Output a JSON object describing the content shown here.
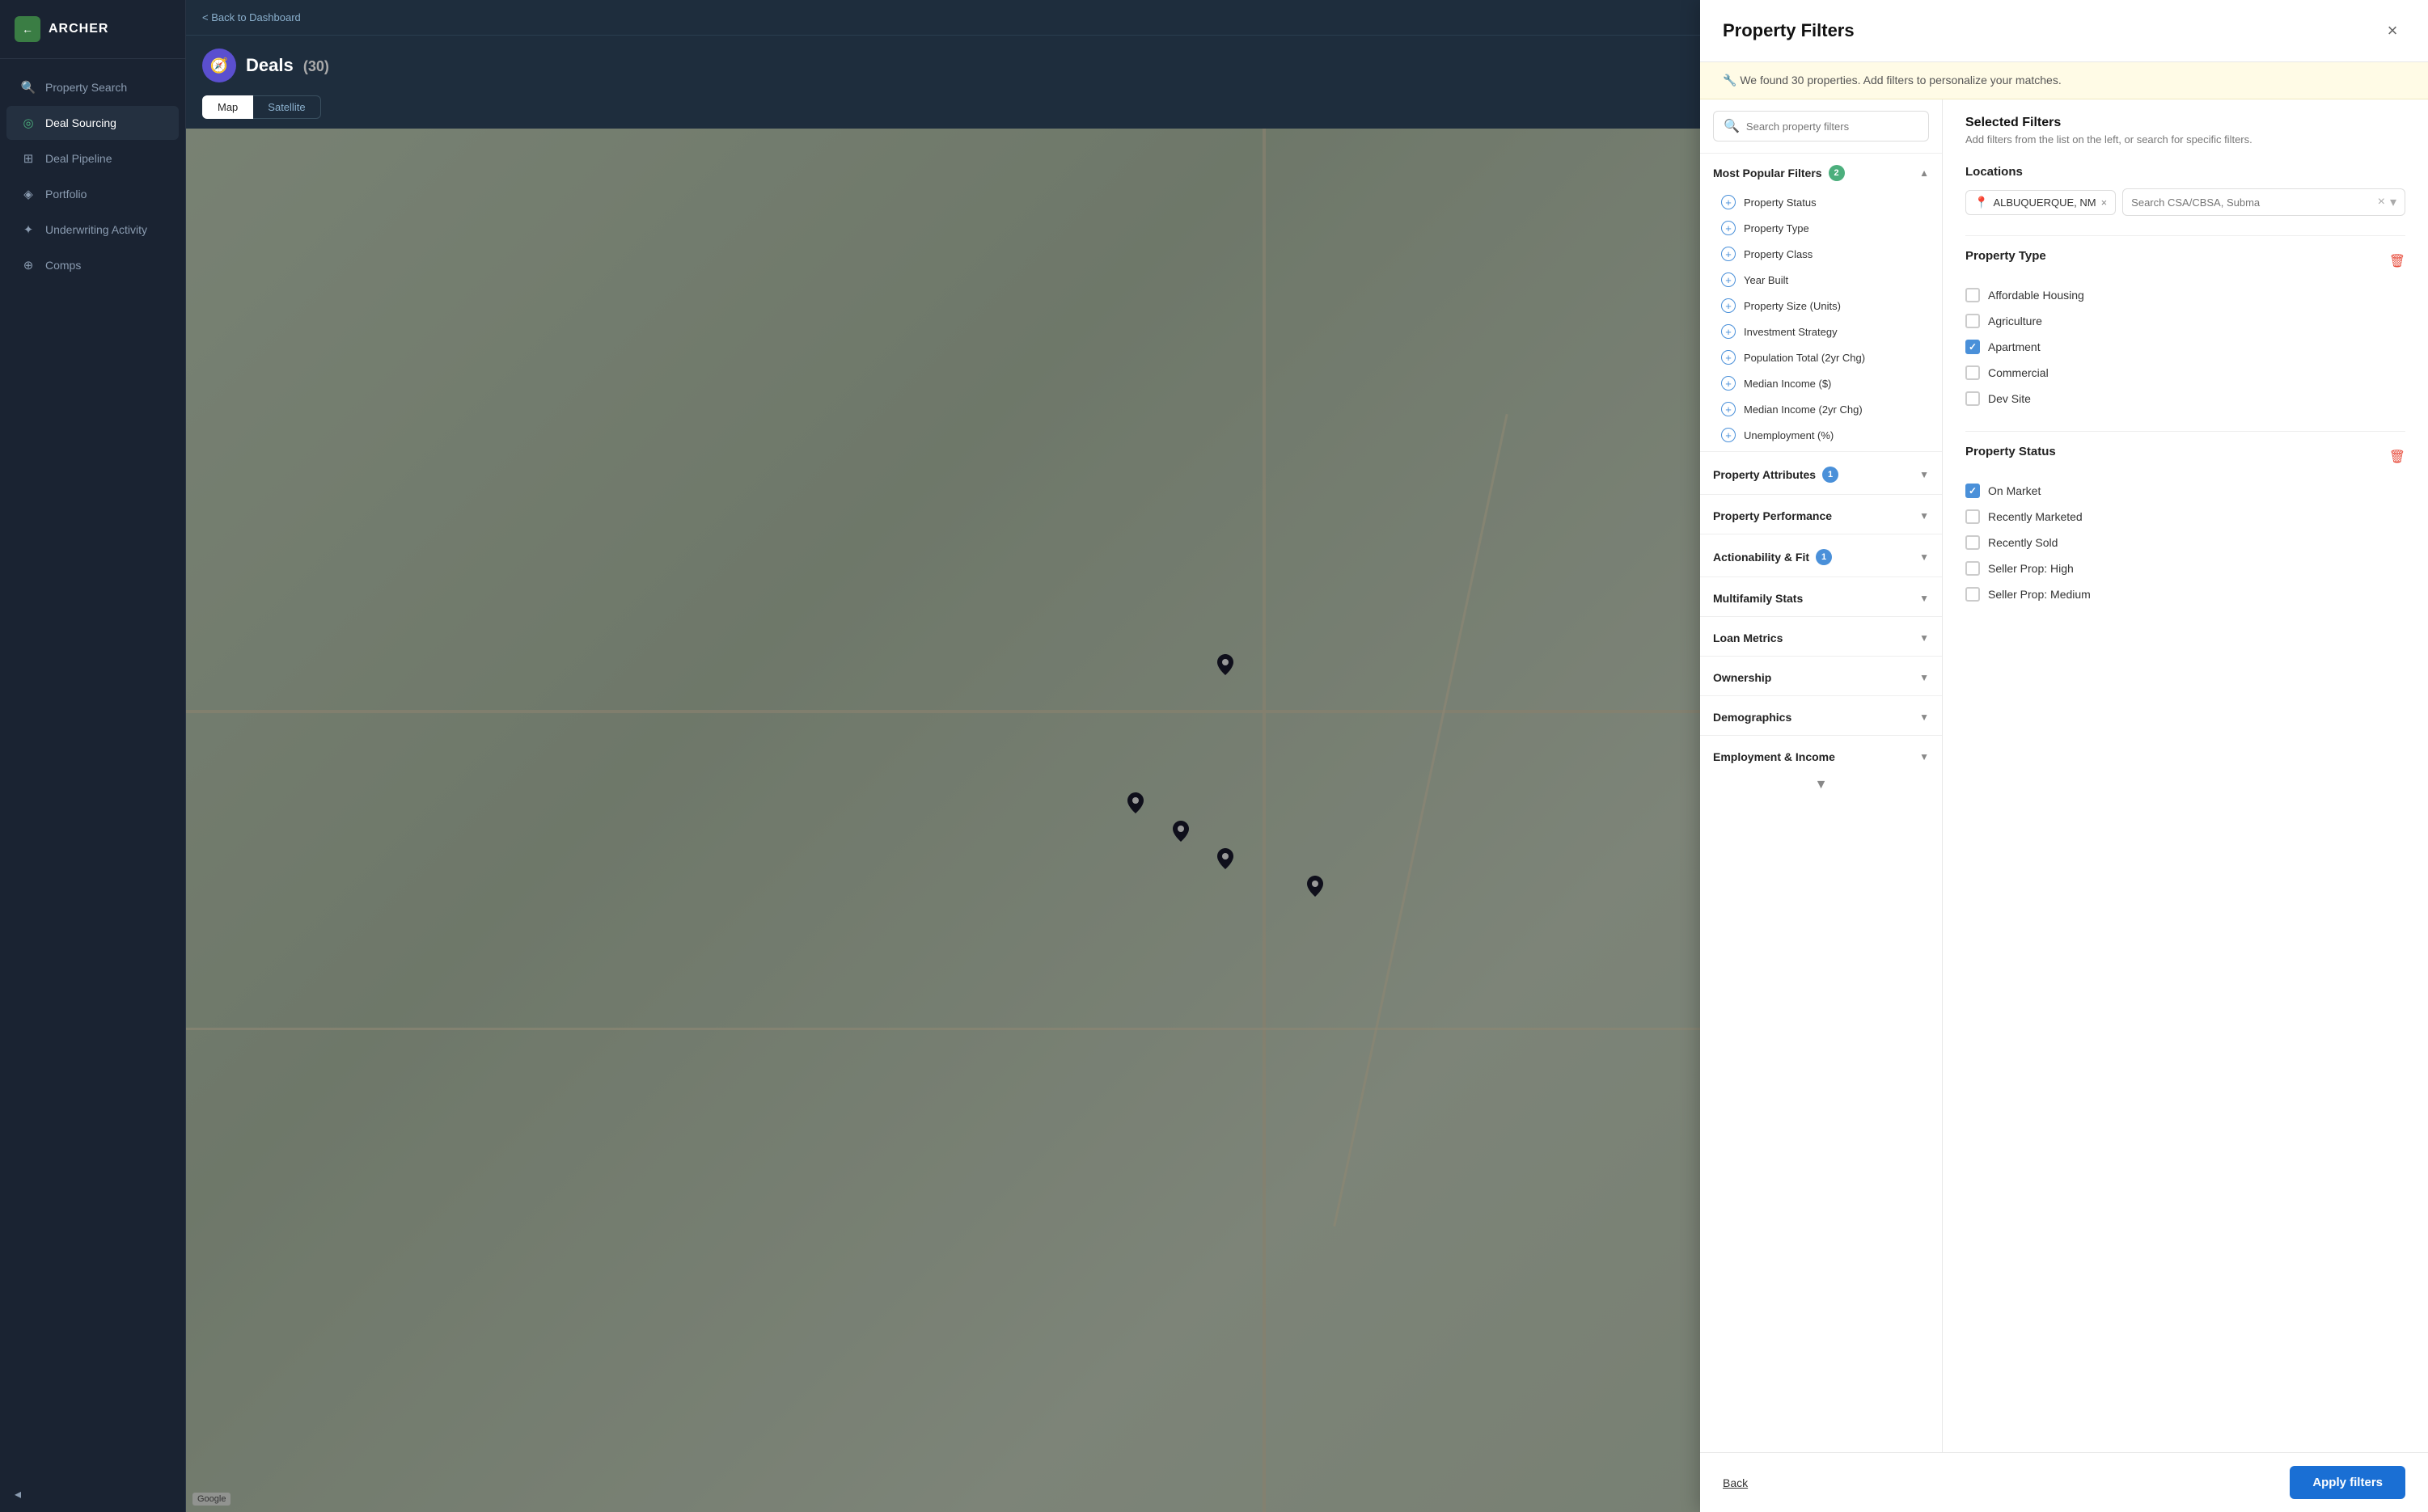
{
  "app": {
    "name": "ARCHER"
  },
  "sidebar": {
    "nav_items": [
      {
        "id": "property-search",
        "label": "Property Search",
        "icon": "🔍",
        "active": false
      },
      {
        "id": "deal-sourcing",
        "label": "Deal Sourcing",
        "icon": "◎",
        "active": true
      },
      {
        "id": "deal-pipeline",
        "label": "Deal Pipeline",
        "icon": "⊞",
        "active": false
      },
      {
        "id": "portfolio",
        "label": "Portfolio",
        "icon": "◈",
        "active": false
      },
      {
        "id": "underwriting-activity",
        "label": "Underwriting Activity",
        "icon": "✦",
        "active": false
      },
      {
        "id": "comps",
        "label": "Comps",
        "icon": "⊕",
        "active": false
      }
    ],
    "collapse_label": "Collapse"
  },
  "main": {
    "breadcrumb": "< Back to Dashboard",
    "deals_title": "Deals",
    "deals_count": "(30)",
    "map_tabs": [
      "Map",
      "Satellite"
    ],
    "active_tab": "Map"
  },
  "modal": {
    "title": "Property Filters",
    "close_label": "×",
    "banner_text": "🔧 We found 30 properties. Add filters to personalize your matches.",
    "search_placeholder": "Search property filters",
    "filter_groups": [
      {
        "id": "most-popular",
        "label": "Most Popular Filters",
        "badge": "2",
        "badge_color": "green",
        "expanded": true,
        "items": [
          "Property Status",
          "Property Type",
          "Property Class",
          "Year Built",
          "Property Size (Units)",
          "Investment Strategy",
          "Population Total (2yr Chg)",
          "Median Income ($)",
          "Median Income (2yr Chg)",
          "Unemployment (%)"
        ]
      },
      {
        "id": "property-attributes",
        "label": "Property Attributes",
        "badge": "1",
        "badge_color": "blue",
        "expanded": false,
        "items": []
      },
      {
        "id": "property-performance",
        "label": "Property Performance",
        "badge": null,
        "expanded": false,
        "items": []
      },
      {
        "id": "actionability-fit",
        "label": "Actionability & Fit",
        "badge": "1",
        "badge_color": "blue",
        "expanded": false,
        "items": []
      },
      {
        "id": "multifamily-stats",
        "label": "Multifamily Stats",
        "badge": null,
        "expanded": false,
        "items": []
      },
      {
        "id": "loan-metrics",
        "label": "Loan Metrics",
        "badge": null,
        "expanded": false,
        "items": []
      },
      {
        "id": "ownership",
        "label": "Ownership",
        "badge": null,
        "expanded": false,
        "items": []
      },
      {
        "id": "demographics",
        "label": "Demographics",
        "badge": null,
        "expanded": false,
        "items": []
      },
      {
        "id": "employment-income",
        "label": "Employment & Income",
        "badge": null,
        "expanded": false,
        "items": []
      }
    ],
    "selected_filters": {
      "title": "Selected Filters",
      "subtitle": "Add filters from the list on the left, or search for specific filters.",
      "locations": {
        "label": "Locations",
        "chips": [
          "ALBUQUERQUE, NM"
        ],
        "search_placeholder": "Search CSA/CBSA, Subma"
      },
      "property_type": {
        "label": "Property Type",
        "options": [
          {
            "label": "Affordable Housing",
            "checked": false
          },
          {
            "label": "Agriculture",
            "checked": false
          },
          {
            "label": "Apartment",
            "checked": true
          },
          {
            "label": "Commercial",
            "checked": false
          },
          {
            "label": "Dev Site",
            "checked": false
          }
        ]
      },
      "property_status": {
        "label": "Property Status",
        "options": [
          {
            "label": "On Market",
            "checked": true
          },
          {
            "label": "Recently Marketed",
            "checked": false
          },
          {
            "label": "Recently Sold",
            "checked": false
          },
          {
            "label": "Seller Prop: High",
            "checked": false
          },
          {
            "label": "Seller Prop: Medium",
            "checked": false
          }
        ]
      }
    },
    "footer": {
      "back_label": "Back",
      "apply_label": "Apply filters"
    }
  }
}
